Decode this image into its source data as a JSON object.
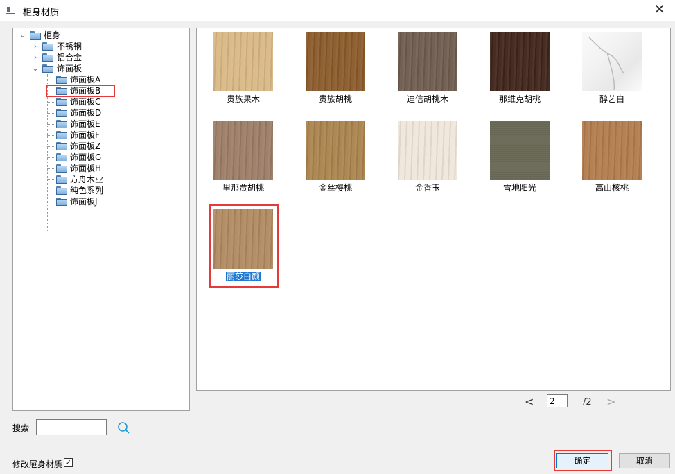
{
  "window": {
    "title": "柜身材质",
    "close_glyph": "✕"
  },
  "tree": {
    "root": "柜身",
    "children": [
      {
        "label": "不锈钢",
        "expanded": false
      },
      {
        "label": "铝合金",
        "expanded": false
      },
      {
        "label": "饰面板",
        "expanded": true,
        "items": [
          "饰面板A",
          "饰面板B",
          "饰面板C",
          "饰面板D",
          "饰面板E",
          "饰面板F",
          "饰面板Z",
          "饰面板G",
          "饰面板H",
          "方舟木业",
          "纯色系列",
          "饰面板J"
        ],
        "selected": "饰面板B"
      }
    ]
  },
  "materials": [
    {
      "name": "贵族果木",
      "color": "#d8b884"
    },
    {
      "name": "贵族胡桃",
      "color": "#8a5a2a"
    },
    {
      "name": "迪信胡桃木",
      "color": "#6e5b4e"
    },
    {
      "name": "那维克胡桃",
      "color": "#3e241a"
    },
    {
      "name": "醇艺白",
      "color": "#f2f2f2"
    },
    {
      "name": "里那贾胡桃",
      "color": "#9c7d66"
    },
    {
      "name": "金丝樱桃",
      "color": "#a9834c"
    },
    {
      "name": "金香玉",
      "color": "#f0e6da"
    },
    {
      "name": "雪地阳光",
      "color": "#a6a596"
    },
    {
      "name": "高山核桃",
      "color": "#b07c4c"
    },
    {
      "name": "丽莎白颜",
      "color": "#b08a61",
      "selected": true
    }
  ],
  "pager": {
    "prev": "<",
    "current": "2",
    "total": "/2",
    "next": ">"
  },
  "search": {
    "label": "搜索",
    "value": ""
  },
  "options": {
    "modify_label": "修改屉身材质",
    "checked_glyph": "☑",
    "checked": true
  },
  "buttons": {
    "ok": "确定",
    "cancel": "取消"
  }
}
